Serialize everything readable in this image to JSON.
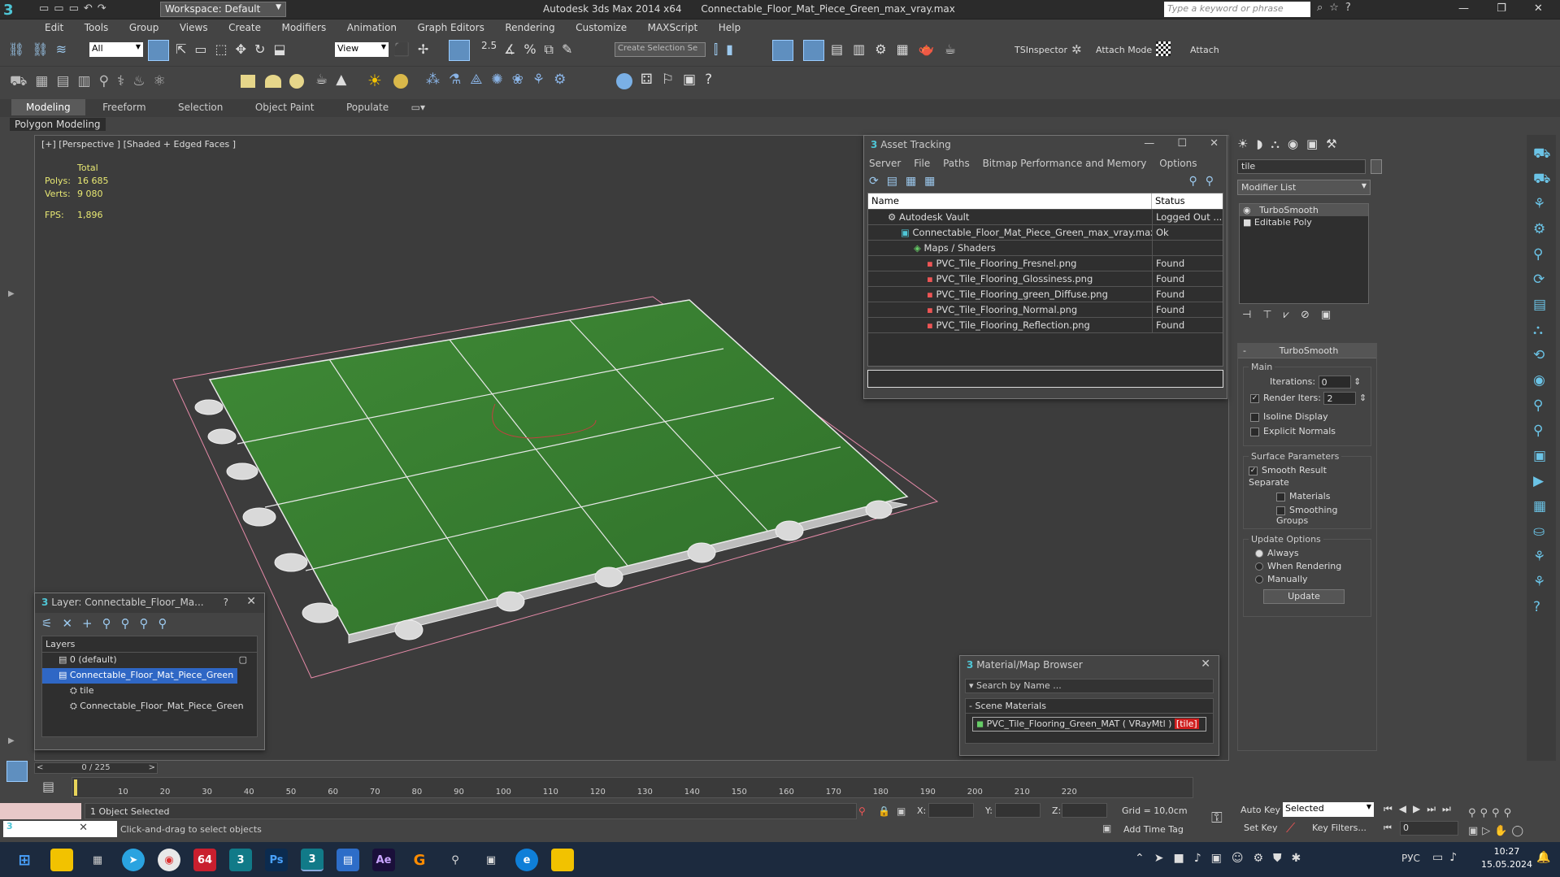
{
  "app": {
    "workspace_label": "Workspace: Default",
    "title": "Autodesk 3ds Max  2014 x64",
    "file_name": "Connectable_Floor_Mat_Piece_Green_max_vray.max",
    "search_placeholder": "Type a keyword or phrase"
  },
  "menu": [
    "Edit",
    "Tools",
    "Group",
    "Views",
    "Create",
    "Modifiers",
    "Animation",
    "Graph Editors",
    "Rendering",
    "Customize",
    "MAXScript",
    "Help"
  ],
  "toolbar": {
    "selection_filter": "All",
    "ref_coord": "View",
    "snap_value": "2.5",
    "named_selection_placeholder": "Create Selection Se",
    "tsinspector": "TSInspector",
    "attach_mode": "Attach Mode",
    "attach": "Attach"
  },
  "ribbon": {
    "tabs": [
      "Modeling",
      "Freeform",
      "Selection",
      "Object Paint",
      "Populate"
    ],
    "sub": "Polygon Modeling"
  },
  "viewport": {
    "label": "[+] [Perspective ] [Shaded + Edged Faces ]",
    "stats_header": "Total",
    "polys_label": "Polys:",
    "polys_value": "16 685",
    "verts_label": "Verts:",
    "verts_value": "9 080",
    "fps_label": "FPS:",
    "fps_value": "1,896"
  },
  "asset_tracking": {
    "title": "Asset Tracking",
    "menu": [
      "Server",
      "File",
      "Paths",
      "Bitmap Performance and Memory",
      "Options"
    ],
    "col_name": "Name",
    "col_status": "Status",
    "rows": [
      {
        "name": "Autodesk Vault",
        "status": "Logged Out ..."
      },
      {
        "name": "Connectable_Floor_Mat_Piece_Green_max_vray.max",
        "status": "Ok"
      },
      {
        "name": "Maps / Shaders",
        "status": ""
      },
      {
        "name": "PVC_Tile_Flooring_Fresnel.png",
        "status": "Found"
      },
      {
        "name": "PVC_Tile_Flooring_Glossiness.png",
        "status": "Found"
      },
      {
        "name": "PVC_Tile_Flooring_green_Diffuse.png",
        "status": "Found"
      },
      {
        "name": "PVC_Tile_Flooring_Normal.png",
        "status": "Found"
      },
      {
        "name": "PVC_Tile_Flooring_Reflection.png",
        "status": "Found"
      }
    ]
  },
  "layer_window": {
    "title": "Layer: Connectable_Floor_Ma...",
    "help": "?",
    "header": "Layers",
    "items": [
      {
        "label": "0 (default)"
      },
      {
        "label": "Connectable_Floor_Mat_Piece_Green"
      },
      {
        "label": "tile"
      },
      {
        "label": "Connectable_Floor_Mat_Piece_Green"
      }
    ]
  },
  "material_browser": {
    "title": "Material/Map Browser",
    "search_placeholder": "Search by Name ...",
    "section": "Scene Materials",
    "item": "PVC_Tile_Flooring_Green_MAT  ( VRayMtl )",
    "item_tag": "[tile]"
  },
  "command_panel": {
    "object_name": "tile",
    "modifier_list": "Modifier List",
    "stack": [
      "TurboSmooth",
      "Editable Poly"
    ],
    "rollout_title": "TurboSmooth",
    "main_label": "Main",
    "iterations_label": "Iterations:",
    "iterations_value": "0",
    "render_iters_label": "Render Iters:",
    "render_iters_value": "2",
    "isoline": "Isoline Display",
    "explicit_normals": "Explicit Normals",
    "surface_params": "Surface Parameters",
    "smooth_result": "Smooth Result",
    "separate": "Separate",
    "materials": "Materials",
    "smoothing_groups": "Smoothing Groups",
    "update_options": "Update Options",
    "always": "Always",
    "when_rendering": "When Rendering",
    "manually": "Manually",
    "update_button": "Update"
  },
  "timeline": {
    "frame_counter": "0 / 225",
    "ticks": [
      "10",
      "20",
      "30",
      "40",
      "50",
      "60",
      "70",
      "80",
      "90",
      "100",
      "110",
      "120",
      "130",
      "140",
      "150",
      "160",
      "170",
      "180",
      "190",
      "200",
      "210",
      "220"
    ],
    "status_selected": "1 Object Selected",
    "prompt": "Click-and-drag to select objects",
    "x_label": "X:",
    "y_label": "Y:",
    "z_label": "Z:",
    "grid": "Grid = 10,0cm",
    "add_time_tag": "Add Time Tag",
    "auto_key": "Auto Key",
    "set_key": "Set Key",
    "key_mode": "Selected",
    "key_filters": "Key Filters...",
    "current_frame": "0"
  },
  "taskbar": {
    "badge": "64",
    "lang": "РУС",
    "time": "10:27",
    "date": "15.05.2024"
  }
}
